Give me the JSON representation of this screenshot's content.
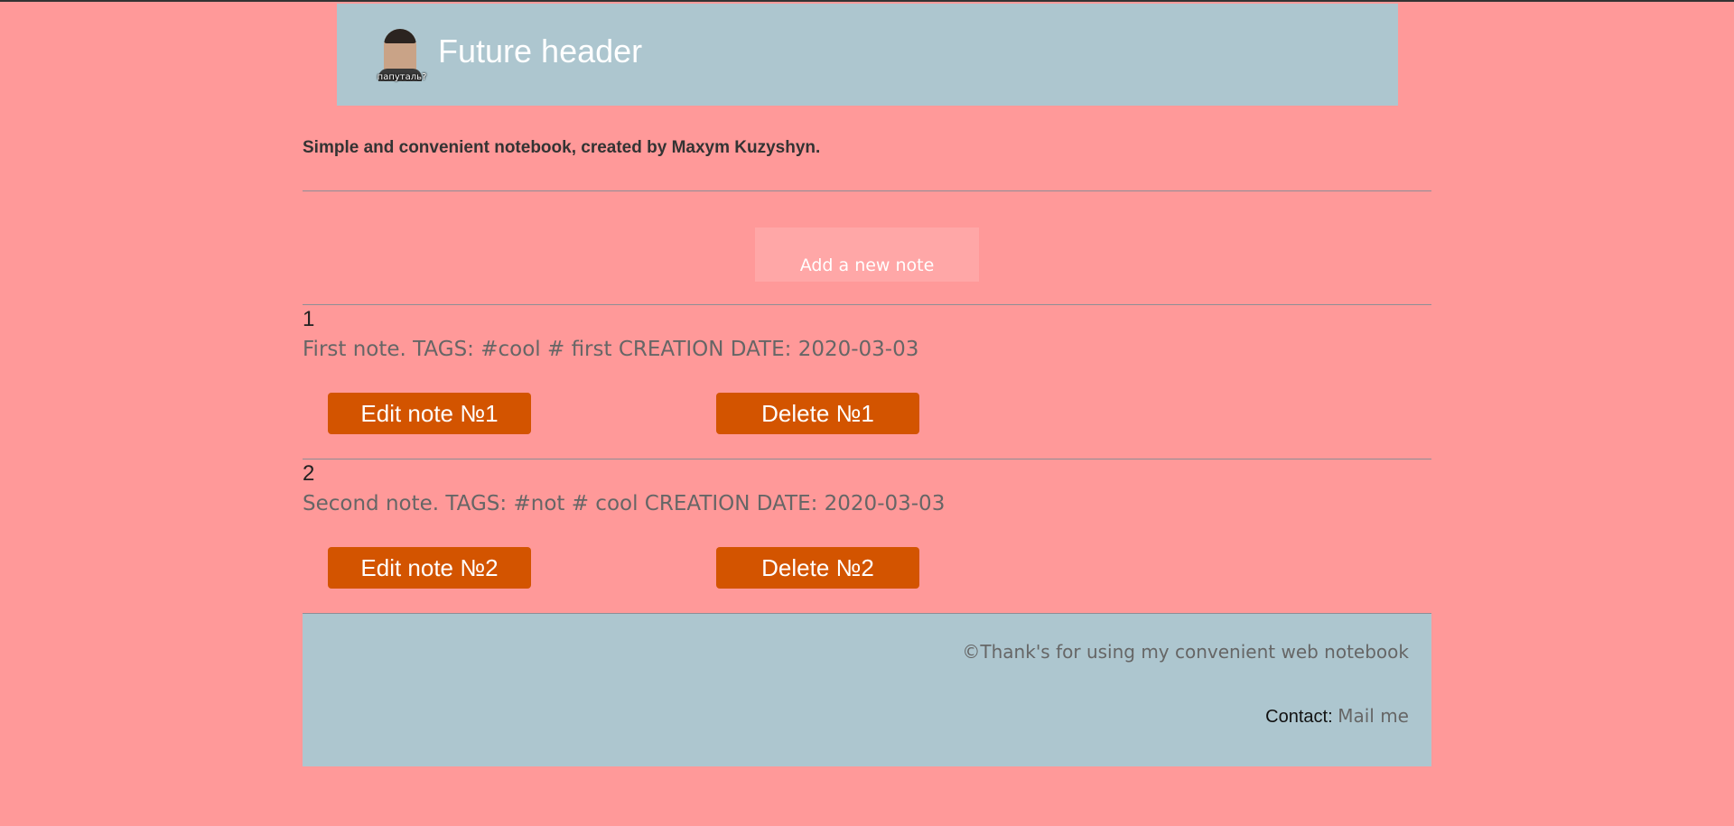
{
  "header": {
    "avatar_caption": "папуталь?",
    "title": "Future header"
  },
  "intro": "Simple and convenient notebook, created by Maxym Kuzyshyn.",
  "add_note_label": "Add a new note",
  "notes": [
    {
      "number": "1",
      "text": "First note. TAGS: #cool # first CREATION DATE: 2020-03-03",
      "edit_label": "Edit note №1",
      "delete_label": "Delete №1"
    },
    {
      "number": "2",
      "text": "Second note. TAGS: #not # cool CREATION DATE: 2020-03-03",
      "edit_label": "Edit note №2",
      "delete_label": "Delete №2"
    }
  ],
  "footer": {
    "thanks": "©Thank's for using my convenient web notebook",
    "contact_label": "Contact:",
    "contact_link": "Mail me"
  },
  "colors": {
    "page_bg": "#ff9999",
    "header_bg": "#adc6cf",
    "button_orange": "#d35400"
  }
}
